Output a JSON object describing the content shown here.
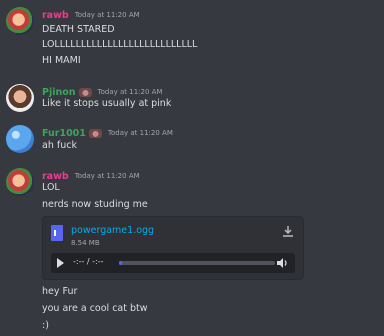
{
  "messages": [
    {
      "author": "rawb",
      "timestamp": "Today at 11:20 AM",
      "lines": [
        "DEATH STARED",
        "LOLLLLLLLLLLLLLLLLLLLLLLLLLLL",
        "HI MAMI"
      ]
    },
    {
      "author": "Pjinon",
      "timestamp": "Today at 11:20 AM",
      "lines": [
        "Like it stops usually at pink"
      ]
    },
    {
      "author": "Fur1001",
      "timestamp": "Today at 11:20 AM",
      "lines": [
        "ah fuck"
      ]
    },
    {
      "author": "rawb",
      "timestamp": "Today at 11:20 AM",
      "lines": [
        "LOL",
        "nerds now studing me"
      ],
      "attachment": {
        "filename": "powergame1.ogg",
        "size": "8.54 MB",
        "time": "-:-- / -:--",
        "progress": 0.02
      },
      "after_lines": [
        "hey Fur",
        "you are a cool cat btw",
        ":)"
      ]
    }
  ],
  "colors": {
    "background": "#36393f",
    "rawb": "#e83d8f",
    "green_names": "#3ba55c",
    "link": "#00aff4",
    "accent": "#5865f2"
  },
  "icons": [
    "avatar",
    "badge-icon",
    "audio-file-icon",
    "download-icon",
    "play-icon",
    "volume-icon"
  ]
}
